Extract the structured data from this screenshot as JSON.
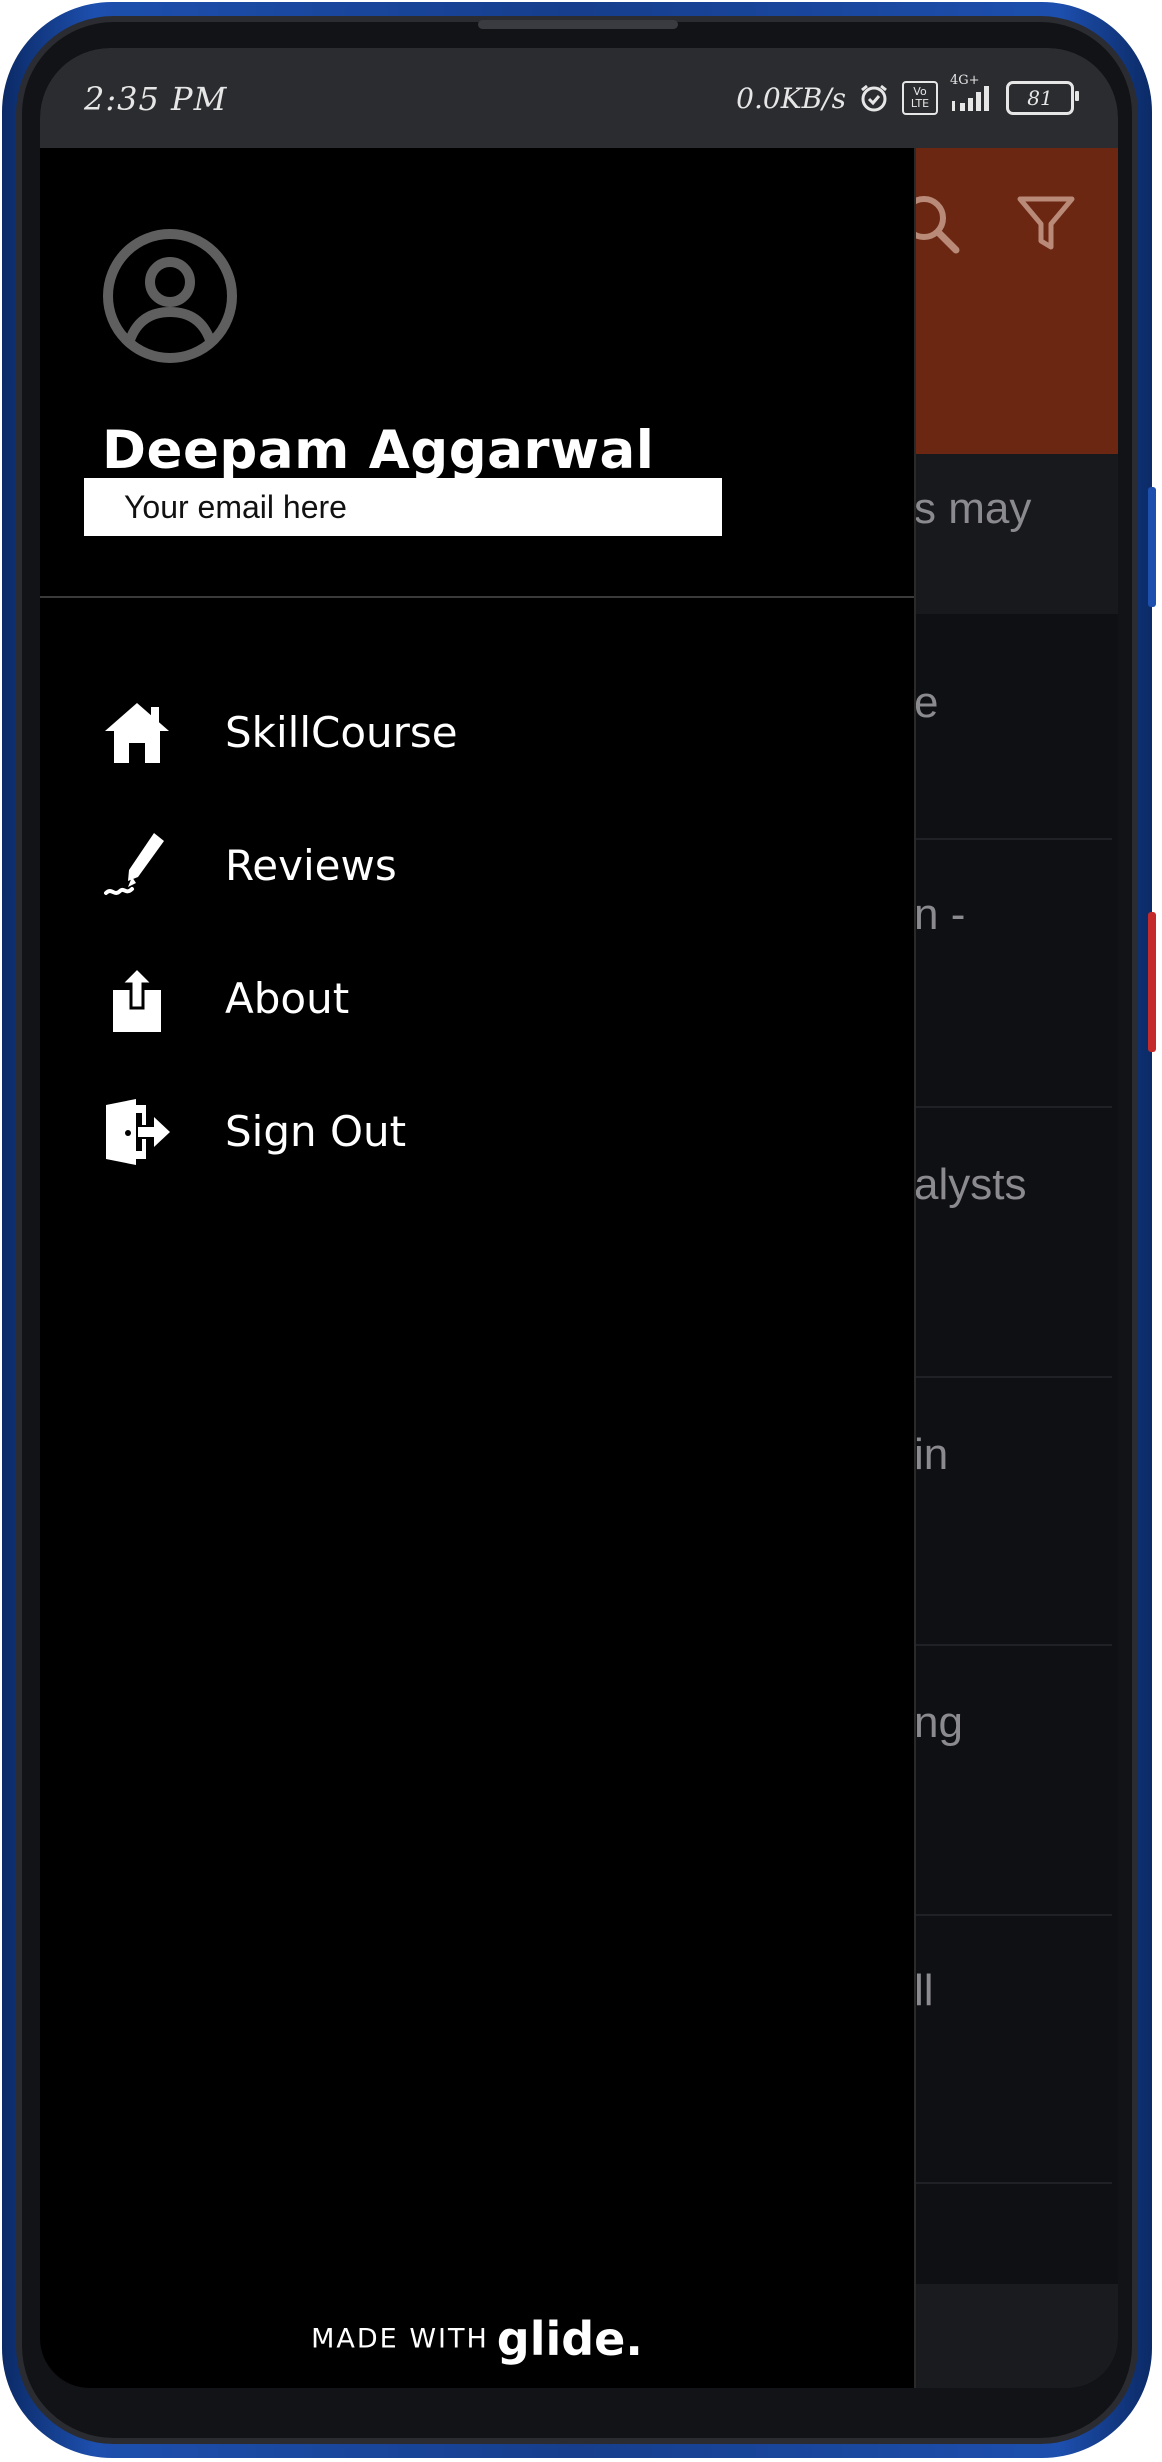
{
  "status_bar": {
    "time": "2:35 PM",
    "network_speed": "0.0KB/s",
    "volte_line1": "Vo",
    "volte_line2": "LTE",
    "network_type": "4G+",
    "battery": "81"
  },
  "background_app": {
    "header_color": "#6b2712",
    "subtitle_fragment": "s may",
    "list_fragments": [
      "e",
      "n -",
      "alysts",
      "in",
      "ng",
      "ll"
    ]
  },
  "drawer": {
    "user_name": "Deepam Aggarwal",
    "email_placeholder": "Your email here",
    "menu": [
      {
        "label": "SkillCourse",
        "icon": "home-icon"
      },
      {
        "label": "Reviews",
        "icon": "pen-signature-icon"
      },
      {
        "label": "About",
        "icon": "share-upload-icon"
      },
      {
        "label": "Sign Out",
        "icon": "sign-out-icon"
      }
    ],
    "footer": {
      "prefix": "MADE WITH",
      "brand": "glide."
    }
  }
}
